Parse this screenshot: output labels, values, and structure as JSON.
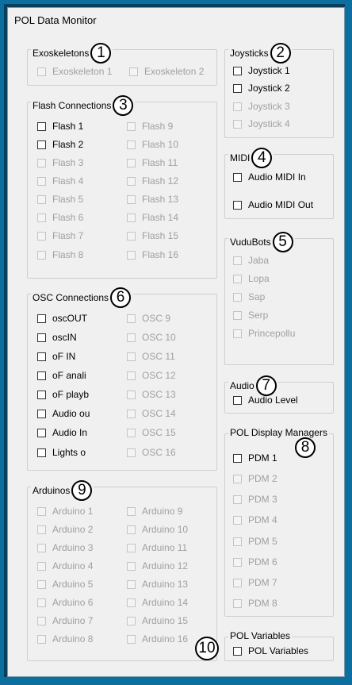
{
  "window": {
    "title": "POL Data Monitor"
  },
  "groups": {
    "exo": {
      "label": "Exoskeletons",
      "badge": "1",
      "items": [
        "Exoskeleton 1",
        "Exoskeleton 2"
      ]
    },
    "joy": {
      "label": "Joysticks",
      "badge": "2",
      "items": [
        "Joystick 1",
        "Joystick 2",
        "Joystick 3",
        "Joystick 4"
      ]
    },
    "flash": {
      "label": "Flash Connections",
      "badge": "3",
      "items": [
        "Flash 1",
        "Flash 2",
        "Flash 3",
        "Flash 4",
        "Flash 5",
        "Flash 6",
        "Flash 7",
        "Flash 8",
        "Flash 9",
        "Flash 10",
        "Flash 11",
        "Flash 12",
        "Flash 13",
        "Flash 14",
        "Flash 15",
        "Flash 16"
      ]
    },
    "midi": {
      "label": "MIDI",
      "badge": "4",
      "items": [
        "Audio MIDI In",
        "Audio MIDI Out"
      ]
    },
    "vudu": {
      "label": "VuduBots",
      "badge": "5",
      "items": [
        "Jaba",
        "Lopa",
        "Sap",
        "Serp",
        "Princepollu"
      ]
    },
    "osc": {
      "label": "OSC Connections",
      "badge": "6",
      "items": [
        "oscOUT",
        "oscIN",
        "oF IN",
        "oF anali",
        "oF playb",
        "Audio ou",
        "Audio In",
        "Lights o",
        "OSC 9",
        "OSC 10",
        "OSC 11",
        "OSC 12",
        "OSC 13",
        "OSC 14",
        "OSC 15",
        "OSC 16"
      ]
    },
    "audio": {
      "label": "Audio",
      "badge": "7",
      "items": [
        "Audio Level"
      ]
    },
    "pdm": {
      "label": "POL Display Managers",
      "badge": "8",
      "items": [
        "PDM 1",
        "PDM 2",
        "PDM 3",
        "PDM 4",
        "PDM 5",
        "PDM 6",
        "PDM 7",
        "PDM 8"
      ]
    },
    "ard": {
      "label": "Arduinos",
      "badge": "9",
      "items": [
        "Arduino 1",
        "Arduino 2",
        "Arduino 3",
        "Arduino 4",
        "Arduino 5",
        "Arduino 6",
        "Arduino 7",
        "Arduino 8",
        "Arduino 9",
        "Arduino 10",
        "Arduino 11",
        "Arduino 12",
        "Arduino 13",
        "Arduino 14",
        "Arduino 15",
        "Arduino 16"
      ]
    },
    "polvar": {
      "label": "POL Variables",
      "badge": "10",
      "items": [
        "POL Variables"
      ]
    }
  }
}
